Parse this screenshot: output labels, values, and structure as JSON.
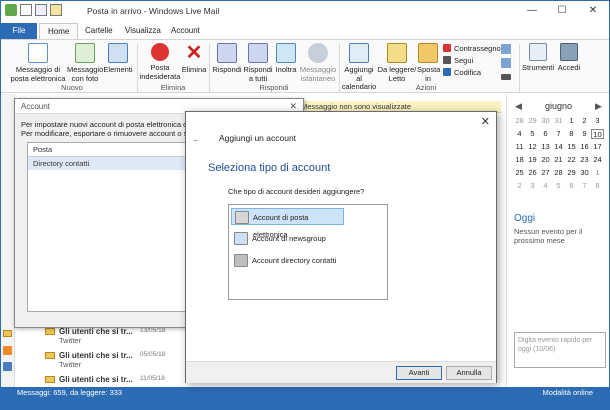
{
  "window": {
    "title": "Posta in arrivo - Windows Live Mail",
    "minimize": "—",
    "maximize": "☐",
    "close": "✕"
  },
  "tabs": [
    "File",
    "Home",
    "Cartelle",
    "Visualizza",
    "Account"
  ],
  "ribbon": {
    "nuovo": {
      "label": "Nuovo",
      "email": "Messaggio di posta elettronica",
      "photo": "Messaggio con foto",
      "items": "Elementi"
    },
    "elimina": {
      "label": "Elimina",
      "junk": "Posta indesiderata",
      "delete": "Elimina"
    },
    "rispondi": {
      "label": "Rispondi",
      "reply": "Rispondi",
      "reply_all": "Rispondi a tutti",
      "forward": "Inoltra",
      "im": "Messaggio istantaneo"
    },
    "azioni": {
      "label": "Azioni",
      "calendar": "Aggiungi al calendario",
      "read_unread": "Da leggere/ Letto",
      "move": "Sposta in",
      "watch": "Contrassegno",
      "follow": "Segui",
      "encoding": "Codifica"
    },
    "tools": {
      "tools": "Strumenti",
      "signin": "Accedi"
    }
  },
  "message_bar": "Messaggio non sono visualizzate",
  "messages": [
    {
      "subject": "Gli utenti che si tr...",
      "from": "Twitter",
      "date": "13/05/18"
    },
    {
      "subject": "Gli utenti che si tr...",
      "from": "Twitter",
      "date": "05/05/18"
    },
    {
      "subject": "Gli utenti che si tr...",
      "from": "Twitter",
      "date": "11/05/18"
    }
  ],
  "calendar": {
    "month": "giugno",
    "prev": "◀",
    "next": "▶",
    "weeks": [
      [
        "28",
        "29",
        "30",
        "31",
        "1",
        "2",
        "3"
      ],
      [
        "4",
        "5",
        "6",
        "7",
        "8",
        "9",
        "10"
      ],
      [
        "11",
        "12",
        "13",
        "14",
        "15",
        "16",
        "17"
      ],
      [
        "18",
        "19",
        "20",
        "21",
        "22",
        "23",
        "24"
      ],
      [
        "25",
        "26",
        "27",
        "28",
        "29",
        "30",
        "1"
      ],
      [
        "2",
        "3",
        "4",
        "5",
        "6",
        "7",
        "8"
      ]
    ],
    "today": "10",
    "today_title": "Oggi",
    "today_text": "Nessun evento per il prossimo mese",
    "quick_event": "Digita evento rapido per oggi (10/06)"
  },
  "status": {
    "left": "Messaggi: 659, da leggere: 333",
    "right": "Modalità online"
  },
  "account_dialog": {
    "title": "Account",
    "close": "✕",
    "desc1": "Per impostare nuovi account di posta elettronica o sottoscri",
    "desc2": "Per modificare, esportare o rimuovere account o sottoscrizi",
    "header": "Posta",
    "row": "Directory contatti"
  },
  "add_dialog": {
    "title": "Aggiungi un account",
    "back": "←",
    "close": "✕",
    "heading": "Seleziona tipo di account",
    "question": "Che tipo di account desideri aggiungere?",
    "options": [
      "Account di posta elettronica",
      "Account di newsgroup",
      "Account directory contatti"
    ],
    "next": "Avanti",
    "cancel": "Annulla"
  }
}
